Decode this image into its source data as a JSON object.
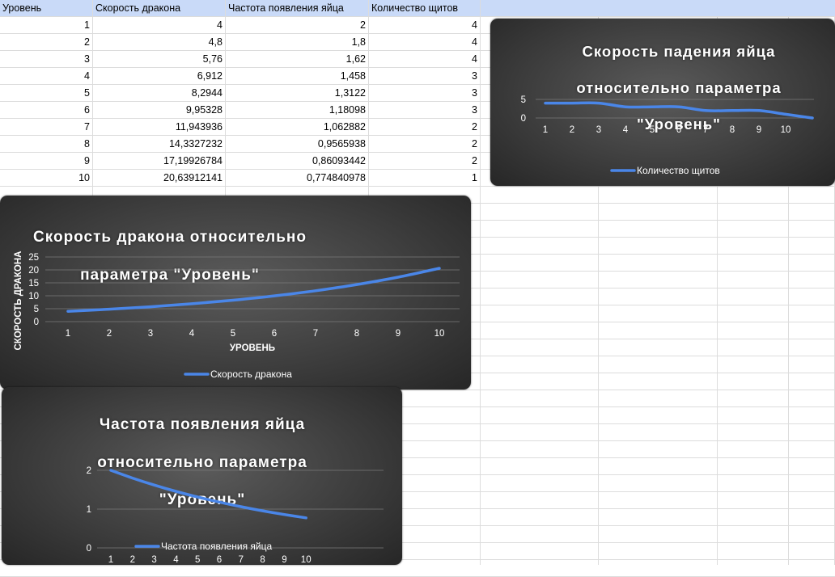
{
  "table": {
    "headers": [
      "Уровень",
      "Скорость дракона",
      "Частота появления яйца",
      "Количество щитов"
    ],
    "rows": [
      [
        "1",
        "4",
        "2",
        "4"
      ],
      [
        "2",
        "4,8",
        "1,8",
        "4"
      ],
      [
        "3",
        "5,76",
        "1,62",
        "4"
      ],
      [
        "4",
        "6,912",
        "1,458",
        "3"
      ],
      [
        "5",
        "8,2944",
        "1,3122",
        "3"
      ],
      [
        "6",
        "9,95328",
        "1,18098",
        "3"
      ],
      [
        "7",
        "11,943936",
        "1,062882",
        "2"
      ],
      [
        "8",
        "14,3327232",
        "0,9565938",
        "2"
      ],
      [
        "9",
        "17,19926784",
        "0,86093442",
        "2"
      ],
      [
        "10",
        "20,63912141",
        "0,774840978",
        "1"
      ]
    ]
  },
  "chart_data": [
    {
      "type": "line",
      "title": "Скорость падения яйца относительно параметра \"Уровень\"",
      "title_lines": [
        "Скорость падения яйца",
        "относительно параметра",
        "\"Уровень\""
      ],
      "xlabel": "",
      "ylabel": "",
      "categories": [
        "1",
        "2",
        "3",
        "4",
        "5",
        "6",
        "7",
        "8",
        "9",
        "10"
      ],
      "series": [
        {
          "name": "Количество щитов",
          "values": [
            4,
            4,
            4,
            3,
            3,
            3,
            2,
            2,
            2,
            1,
            0
          ]
        }
      ],
      "y_ticks": [
        "0",
        "5"
      ],
      "ylim": [
        0,
        5
      ],
      "grid": true,
      "legend": "bottom",
      "color": "#4a86e8"
    },
    {
      "type": "line",
      "title": "Скорость дракона относительно параметра \"Уровень\"",
      "title_lines": [
        "Скорость дракона относительно",
        "параметра \"Уровень\""
      ],
      "xlabel": "УРОВЕНЬ",
      "ylabel": "СКОРОСТЬ ДРАКОНА",
      "categories": [
        "1",
        "2",
        "3",
        "4",
        "5",
        "6",
        "7",
        "8",
        "9",
        "10"
      ],
      "series": [
        {
          "name": "Скорость дракона",
          "values": [
            4,
            4.8,
            5.76,
            6.912,
            8.2944,
            9.95328,
            11.943936,
            14.3327232,
            17.19926784,
            20.63912141
          ]
        }
      ],
      "y_ticks": [
        "0",
        "5",
        "10",
        "15",
        "20",
        "25"
      ],
      "ylim": [
        0,
        25
      ],
      "grid": true,
      "legend": "bottom",
      "color": "#4a86e8"
    },
    {
      "type": "line",
      "title": "Частота появления яйца относительно параметра \"Уровень\"",
      "title_lines": [
        "Частота появления яйца",
        "относительно параметра",
        "\"Уровень\""
      ],
      "xlabel": "",
      "ylabel": "",
      "categories": [
        "1",
        "2",
        "3",
        "4",
        "5",
        "6",
        "7",
        "8",
        "9",
        "10"
      ],
      "series": [
        {
          "name": "Частота появления яйца",
          "values": [
            2,
            1.8,
            1.62,
            1.458,
            1.3122,
            1.18098,
            1.062882,
            0.9565938,
            0.86093442,
            0.774840978
          ]
        }
      ],
      "y_ticks": [
        "0",
        "1",
        "2"
      ],
      "ylim": [
        0,
        2
      ],
      "grid": true,
      "legend": "bottom",
      "color": "#4a86e8"
    }
  ]
}
